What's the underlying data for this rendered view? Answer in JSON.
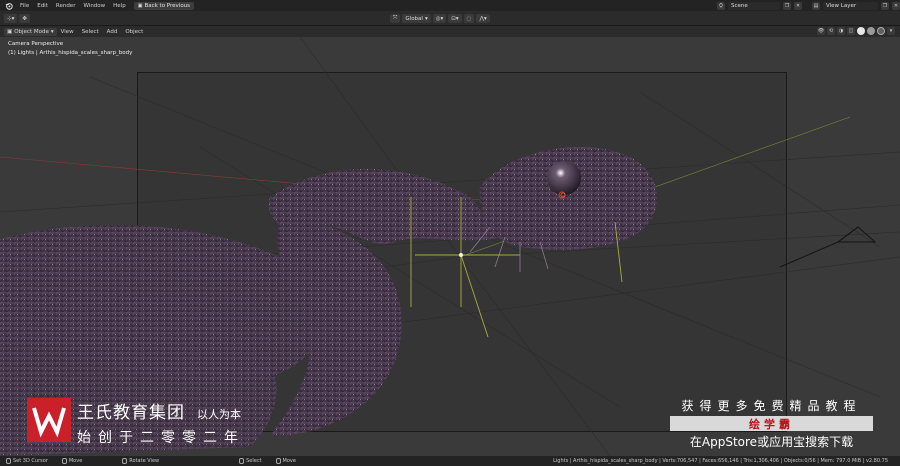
{
  "topbar": {
    "menus": [
      "File",
      "Edit",
      "Render",
      "Window",
      "Help"
    ],
    "back_button": "Back to Previous",
    "scene_label": "Scene",
    "view_layer_label": "View Layer"
  },
  "tool_header": {
    "transform_orientation": "Global"
  },
  "viewport_header": {
    "mode": "Object Mode",
    "menus": [
      "View",
      "Select",
      "Add",
      "Object"
    ]
  },
  "viewport": {
    "view_name": "Camera Perspective",
    "object_info": "(1) Lights | Arthis_hispida_scales_sharp_body"
  },
  "watermark": {
    "company": "王氏教育集团",
    "slogan": "以人为本",
    "founded": "始创于二零零二年",
    "promo_line": "获得更多免费精品教程",
    "brand": "绘学霸",
    "store_line": "在AppStore或应用宝搜索下载"
  },
  "statusbar": {
    "hints": [
      "Set 3D Cursor",
      "Move",
      "Rotate View",
      "Select",
      "Move"
    ],
    "stats": "Lights | Arthis_hispida_scales_sharp_body | Verts:706,547 | Faces:656,146 | Tris:1,306,406 | Objects:0/56 | Mem: 797.0 MiB | v2.80.75"
  },
  "icons": [
    "blender-logo-icon",
    "cursor-tool-icon",
    "transform-icon",
    "mouse-icon",
    "camera-gizmo-icon"
  ],
  "colors": {
    "watermark_red": "#c9202a",
    "brand_text": "#b9121b",
    "camera_frame": "#353535"
  }
}
